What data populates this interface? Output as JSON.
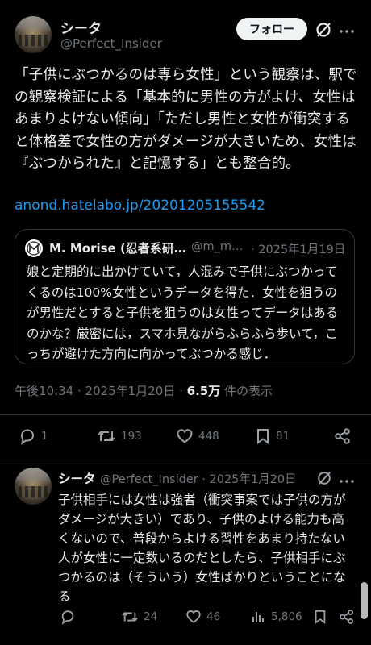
{
  "post": {
    "author_name": "シータ",
    "author_handle": "@Perfect_Insider",
    "follow_label": "フォロー",
    "body": "「子供にぶつかるのは専ら女性」という観察は、駅での観察検証による「基本的に男性の方がよけ、女性はあまりよけない傾向」「ただし男性と女性が衝突すると体格差で女性の方がダメージが大きいため、女性は『ぶつかられた』と記憶する」とも整合的。",
    "link": "anond.hatelabo.jp/20201205155542",
    "quote": {
      "author_name": "M. Morise (忍者系研…",
      "author_handle": "@m_m…",
      "date": "· 2025年1月19日",
      "body": "娘と定期的に出かけていて，人混みで子供にぶつかってくるのは100%女性というデータを得た．女性を狙うのが男性だとすると子供を狙うのは女性ってデータはあるのかな？厳密には，スマホ見ながらふらふら歩いて，こっちが避けた方向に向かってぶつかる感じ．"
    },
    "timestamp": "午後10:34 · 2025年1月20日 · ",
    "views_count": "6.5万",
    "views_label": " 件の表示",
    "actions": {
      "replies": "1",
      "reposts": "193",
      "likes": "448",
      "bookmarks": "81"
    }
  },
  "reply": {
    "author_name": "シータ",
    "author_handle": "@Perfect_Insider · 2025年1月20日",
    "body": "子供相手には女性は強者（衝突事案では子供の方がダメージが大きい）であり、子供のよける能力も高くないので、普段からよける習性をあまり持たない人が女性に一定数いるのだとしたら、子供相手にぶつかるのは（そういう）女性ばかりということになる",
    "actions": {
      "reposts": "24",
      "likes": "46",
      "views": "5,806"
    }
  },
  "icons": [
    "grok-icon",
    "more-icon",
    "reply-icon",
    "repost-icon",
    "like-icon",
    "bookmark-icon",
    "share-icon",
    "views-icon",
    "verified-seal-avatar"
  ]
}
